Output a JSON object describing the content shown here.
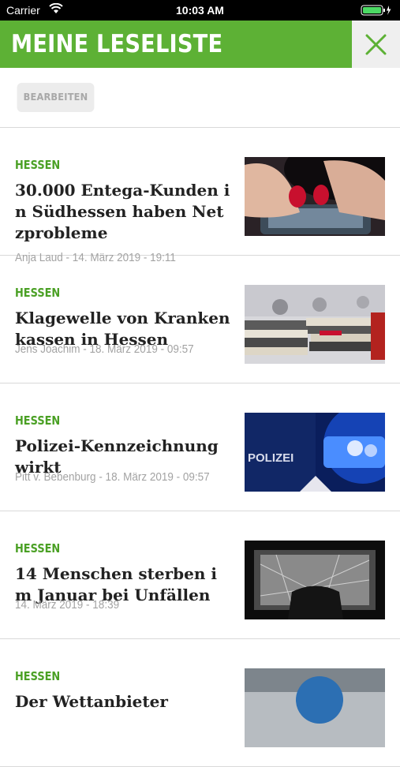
{
  "status_bar": {
    "carrier": "Carrier",
    "time": "10:03 AM"
  },
  "header": {
    "title": "MEINE LESELISTE"
  },
  "toolbar": {
    "edit_label": "BEARBEITEN"
  },
  "articles": [
    {
      "category": "HESSEN",
      "headline": "30.000 Entega-Kunden in Südhessen haben Netzprobleme",
      "meta": "Anja Laud - 14. März 2019 - 19:11"
    },
    {
      "category": "HESSEN",
      "headline": "Klagewelle von Krankenkassen in Hessen",
      "meta": "Jens Joachim - 18. März 2019 - 09:57"
    },
    {
      "category": "HESSEN",
      "headline": "Polizei-Kennzeichnung wirkt",
      "meta": "Pitt v. Bebenburg - 18. März 2019 - 09:57"
    },
    {
      "category": "HESSEN",
      "headline": "14 Menschen sterben im Januar bei Unfällen",
      "meta": "14. März 2019 - 18:39"
    },
    {
      "category": "HESSEN",
      "headline": "Der Wettanbieter",
      "meta": ""
    }
  ],
  "colors": {
    "accent": "#5db135",
    "category": "#4aa024"
  }
}
